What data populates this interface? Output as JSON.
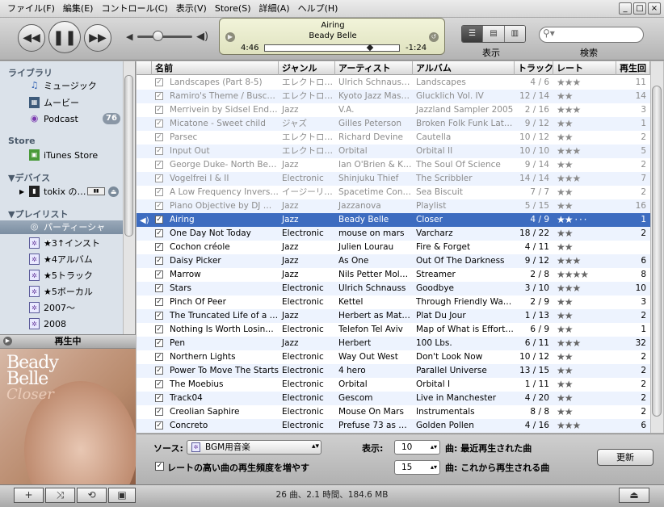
{
  "menu": [
    "ファイル(F)",
    "編集(E)",
    "コントロール(C)",
    "表示(V)",
    "Store(S)",
    "詳細(A)",
    "ヘルプ(H)"
  ],
  "window_buttons": [
    "_",
    "□",
    "×"
  ],
  "lcd": {
    "song": "Airing",
    "artist": "Beady Belle",
    "elapsed": "4:46",
    "remaining": "-1:24",
    "progress": 0.78
  },
  "view_label": "表示",
  "search_label": "検索",
  "sidebar": {
    "library_header": "ライブラリ",
    "library": [
      "ミュージック",
      "ムービー",
      "Podcast"
    ],
    "podcast_badge": "76",
    "store_header": "Store",
    "store": [
      "iTunes Store"
    ],
    "devices_header": "▼デバイス",
    "device": "tokix の…",
    "playlists_header": "▼プレイリスト",
    "playlists": [
      "パーティーシャッ…",
      "★3↑インスト",
      "★4アルバム",
      "★5トラック",
      "★5ボーカル",
      "2007〜",
      "2008"
    ]
  },
  "now_playing_title": "再生中",
  "album_art": {
    "line1": "Beady",
    "line2": "Belle",
    "line3": "Closer"
  },
  "columns": [
    "名前",
    "ジャンル",
    "アーティスト",
    "アルバム",
    "トラック",
    "レート",
    "再生回"
  ],
  "tracks": [
    {
      "name": "Landscapes (Part 8-5)",
      "genre": "エレクトロ…",
      "artist": "Ulrich Schnauss…",
      "album": "Landscapes",
      "track": "4 / 6",
      "rating": 3,
      "plays": "11",
      "state": "dim"
    },
    {
      "name": "Ramiro's Theme / Buscemi",
      "genre": "エレクトロ…",
      "artist": "Kyoto Jazz Mas…",
      "album": "Glucklich Vol. IV",
      "track": "12 / 14",
      "rating": 2,
      "plays": "14",
      "state": "dim"
    },
    {
      "name": "Merrivein by Sidsel Ender…",
      "genre": "Jazz",
      "artist": "V.A.",
      "album": "Jazzland Sampler 2005",
      "track": "2 / 16",
      "rating": 3,
      "plays": "3",
      "state": "dim"
    },
    {
      "name": "Micatone - Sweet child",
      "genre": "ジャズ",
      "artist": "Gilles Peterson",
      "album": "Broken Folk Funk Lati…",
      "track": "9 / 12",
      "rating": 2,
      "plays": "1",
      "state": "dim"
    },
    {
      "name": "Parsec",
      "genre": "エレクトロ…",
      "artist": "Richard Devine",
      "album": "Cautella",
      "track": "10 / 12",
      "rating": 2,
      "plays": "2",
      "state": "dim"
    },
    {
      "name": "Input Out",
      "genre": "エレクトロ…",
      "artist": "Orbital",
      "album": "Orbital II",
      "track": "10 / 10",
      "rating": 3,
      "plays": "5",
      "state": "dim"
    },
    {
      "name": "George Duke- North Beach",
      "genre": "Jazz",
      "artist": "Ian O'Brien & Ki…",
      "album": "The Soul Of Science",
      "track": "9 / 14",
      "rating": 2,
      "plays": "2",
      "state": "dim"
    },
    {
      "name": "Vogelfrei I & II",
      "genre": "Electronic",
      "artist": "Shinjuku Thief",
      "album": "The Scribbler",
      "track": "14 / 14",
      "rating": 3,
      "plays": "7",
      "state": "dim"
    },
    {
      "name": "A Low Frequency Inversi…",
      "genre": "イージーリ…",
      "artist": "Spacetime Con…",
      "album": "Sea Biscuit",
      "track": "7 / 7",
      "rating": 2,
      "plays": "2",
      "state": "dim"
    },
    {
      "name": "Piano Objective by DJ Ma…",
      "genre": "Jazz",
      "artist": "Jazzanova",
      "album": "Playlist",
      "track": "5 / 15",
      "rating": 2,
      "plays": "16",
      "state": "dim"
    },
    {
      "name": "Airing",
      "genre": "Jazz",
      "artist": "Beady Belle",
      "album": "Closer",
      "track": "4 / 9",
      "rating": 2,
      "plays": "1",
      "state": "playing"
    },
    {
      "name": "One Day Not Today",
      "genre": "Electronic",
      "artist": "mouse on mars",
      "album": "Varcharz",
      "track": "18 / 22",
      "rating": 2,
      "plays": "2",
      "state": ""
    },
    {
      "name": "Cochon créole",
      "genre": "Jazz",
      "artist": "Julien Lourau",
      "album": "Fire & Forget",
      "track": "4 / 11",
      "rating": 2,
      "plays": "",
      "state": ""
    },
    {
      "name": "Daisy Picker",
      "genre": "Jazz",
      "artist": "As One",
      "album": "Out Of The Darkness",
      "track": "9 / 12",
      "rating": 3,
      "plays": "6",
      "state": ""
    },
    {
      "name": "Marrow",
      "genre": "Jazz",
      "artist": "Nils Petter Molv…",
      "album": "Streamer",
      "track": "2 / 8",
      "rating": 4,
      "plays": "8",
      "state": ""
    },
    {
      "name": "Stars",
      "genre": "Electronic",
      "artist": "Ulrich Schnauss",
      "album": "Goodbye",
      "track": "3 / 10",
      "rating": 3,
      "plays": "10",
      "state": ""
    },
    {
      "name": "Pinch Of Peer",
      "genre": "Electronic",
      "artist": "Kettel",
      "album": "Through Friendly Wat…",
      "track": "2 / 9",
      "rating": 2,
      "plays": "3",
      "state": ""
    },
    {
      "name": "The Truncated Life of a …",
      "genre": "Jazz",
      "artist": "Herbert as Mat…",
      "album": "Plat Du Jour",
      "track": "1 / 13",
      "rating": 2,
      "plays": "2",
      "state": ""
    },
    {
      "name": "Nothing Is Worth Losing …",
      "genre": "Electronic",
      "artist": "Telefon Tel Aviv",
      "album": "Map of What is Effort…",
      "track": "6 / 9",
      "rating": 2,
      "plays": "1",
      "state": ""
    },
    {
      "name": "Pen",
      "genre": "Jazz",
      "artist": "Herbert",
      "album": "100 Lbs.",
      "track": "6 / 11",
      "rating": 3,
      "plays": "32",
      "state": ""
    },
    {
      "name": "Northern Lights",
      "genre": "Electronic",
      "artist": "Way Out West",
      "album": "Don't Look Now",
      "track": "10 / 12",
      "rating": 2,
      "plays": "2",
      "state": ""
    },
    {
      "name": "Power To Move The Starts",
      "genre": "Electronic",
      "artist": "4 hero",
      "album": "Parallel Universe",
      "track": "13 / 15",
      "rating": 2,
      "plays": "2",
      "state": ""
    },
    {
      "name": "The Moebius",
      "genre": "Electronic",
      "artist": "Orbital",
      "album": "Orbital I",
      "track": "1 / 11",
      "rating": 2,
      "plays": "2",
      "state": ""
    },
    {
      "name": "Track04",
      "genre": "Electronic",
      "artist": "Gescom",
      "album": "Live in Manchester",
      "track": "4 / 20",
      "rating": 2,
      "plays": "2",
      "state": ""
    },
    {
      "name": "Creolian Saphire",
      "genre": "Electronic",
      "artist": "Mouse On Mars",
      "album": "Instrumentals",
      "track": "8 / 8",
      "rating": 2,
      "plays": "2",
      "state": ""
    },
    {
      "name": "Concreto",
      "genre": "Electronic",
      "artist": "Prefuse 73 as …",
      "album": "Golden Pollen",
      "track": "4 / 16",
      "rating": 3,
      "plays": "6",
      "state": ""
    }
  ],
  "party": {
    "source_label": "ソース:",
    "source_value": "BGM用音楽",
    "prefer_label": "レートの高い曲の再生頻度を増やす",
    "display_label": "表示:",
    "recent_count": "10",
    "recent_label": "曲: 最近再生された曲",
    "upcoming_count": "15",
    "upcoming_label": "曲: これから再生される曲",
    "refresh_label": "更新"
  },
  "status": "26 曲、2.1 時間、184.6 MB"
}
